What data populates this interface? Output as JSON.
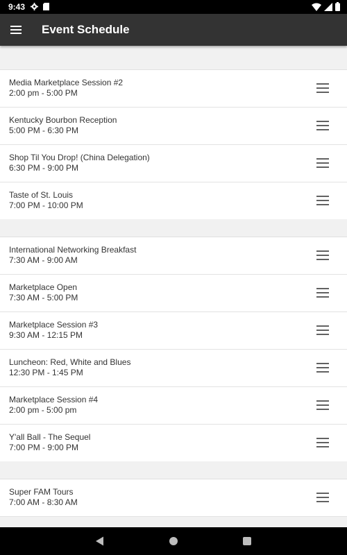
{
  "status_bar": {
    "time": "9:43",
    "icons": [
      "gear-icon",
      "sd-card-icon",
      "wifi-icon",
      "signal-icon",
      "battery-icon"
    ]
  },
  "app_bar": {
    "title": "Event Schedule",
    "menu_icon": "hamburger-menu-icon"
  },
  "day_groups": [
    {
      "events": [
        {
          "name": "Media Marketplace Session #2",
          "time": "2:00 pm - 5:00 PM"
        },
        {
          "name": "Kentucky Bourbon Reception",
          "time": "5:00 PM - 6:30 PM"
        },
        {
          "name": "Shop Til You Drop! (China Delegation)",
          "time": "6:30 PM - 9:00 PM"
        },
        {
          "name": "Taste of St. Louis",
          "time": "7:00 PM - 10:00 PM"
        }
      ]
    },
    {
      "events": [
        {
          "name": "International Networking Breakfast",
          "time": "7:30 AM - 9:00 AM"
        },
        {
          "name": "Marketplace Open",
          "time": "7:30 AM - 5:00 PM"
        },
        {
          "name": "Marketplace Session #3",
          "time": "9:30 AM - 12:15 PM"
        },
        {
          "name": "Luncheon: Red, White and Blues",
          "time": "12:30 PM - 1:45 PM"
        },
        {
          "name": "Marketplace Session #4",
          "time": "2:00 pm - 5:00 pm"
        },
        {
          "name": "Y'all Ball - The Sequel",
          "time": "7:00 PM - 9:00 PM"
        }
      ]
    },
    {
      "events": [
        {
          "name": "Super FAM Tours",
          "time": "7:00 AM - 8:30 AM"
        }
      ]
    }
  ],
  "nav_bar": {
    "icons": [
      "back-icon",
      "home-icon",
      "recents-icon"
    ]
  },
  "colors": {
    "app_bar": "#333333",
    "background": "#f1f1f1",
    "row": "#ffffff",
    "text": "#333333",
    "handle": "#616161"
  }
}
